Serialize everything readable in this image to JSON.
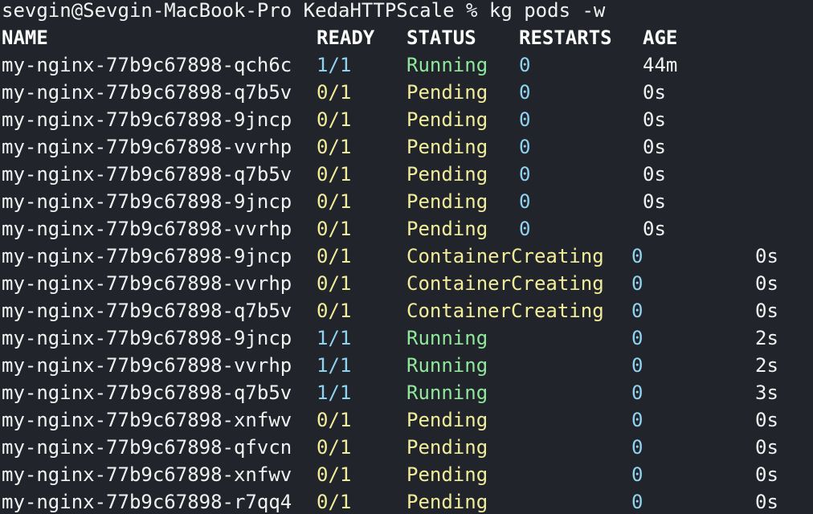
{
  "prompt": {
    "text": "sevgin@Sevgin-MacBook-Pro KedaHTTPScale % kg pods -w"
  },
  "header": {
    "name": "NAME",
    "ready": "READY",
    "status": "STATUS",
    "restarts": "RESTARTS",
    "age": "AGE"
  },
  "rows": [
    {
      "name": "my-nginx-77b9c67898-qch6c",
      "ready": "1/1",
      "status": "Running",
      "restarts": "0",
      "age": "44m"
    },
    {
      "name": "my-nginx-77b9c67898-q7b5v",
      "ready": "0/1",
      "status": "Pending",
      "restarts": "0",
      "age": "0s"
    },
    {
      "name": "my-nginx-77b9c67898-9jncp",
      "ready": "0/1",
      "status": "Pending",
      "restarts": "0",
      "age": "0s"
    },
    {
      "name": "my-nginx-77b9c67898-vvrhp",
      "ready": "0/1",
      "status": "Pending",
      "restarts": "0",
      "age": "0s"
    },
    {
      "name": "my-nginx-77b9c67898-q7b5v",
      "ready": "0/1",
      "status": "Pending",
      "restarts": "0",
      "age": "0s"
    },
    {
      "name": "my-nginx-77b9c67898-9jncp",
      "ready": "0/1",
      "status": "Pending",
      "restarts": "0",
      "age": "0s"
    },
    {
      "name": "my-nginx-77b9c67898-vvrhp",
      "ready": "0/1",
      "status": "Pending",
      "restarts": "0",
      "age": "0s"
    },
    {
      "name": "my-nginx-77b9c67898-9jncp",
      "ready": "0/1",
      "status": "ContainerCreating",
      "restarts": "0",
      "age": "0s"
    },
    {
      "name": "my-nginx-77b9c67898-vvrhp",
      "ready": "0/1",
      "status": "ContainerCreating",
      "restarts": "0",
      "age": "0s"
    },
    {
      "name": "my-nginx-77b9c67898-q7b5v",
      "ready": "0/1",
      "status": "ContainerCreating",
      "restarts": "0",
      "age": "0s"
    },
    {
      "name": "my-nginx-77b9c67898-9jncp",
      "ready": "1/1",
      "status": "Running",
      "restarts": "0",
      "age": "2s"
    },
    {
      "name": "my-nginx-77b9c67898-vvrhp",
      "ready": "1/1",
      "status": "Running",
      "restarts": "0",
      "age": "2s"
    },
    {
      "name": "my-nginx-77b9c67898-q7b5v",
      "ready": "1/1",
      "status": "Running",
      "restarts": "0",
      "age": "3s"
    },
    {
      "name": "my-nginx-77b9c67898-xnfwv",
      "ready": "0/1",
      "status": "Pending",
      "restarts": "0",
      "age": "0s"
    },
    {
      "name": "my-nginx-77b9c67898-qfvcn",
      "ready": "0/1",
      "status": "Pending",
      "restarts": "0",
      "age": "0s"
    },
    {
      "name": "my-nginx-77b9c67898-xnfwv",
      "ready": "0/1",
      "status": "Pending",
      "restarts": "0",
      "age": "0s"
    },
    {
      "name": "my-nginx-77b9c67898-r7qq4",
      "ready": "0/1",
      "status": "Pending",
      "restarts": "0",
      "age": "0s"
    }
  ],
  "colors": {
    "background": "#21252b",
    "foreground": "#f2f2f2",
    "running": "#8fe89b",
    "pending": "#f2ed9a",
    "ready_full": "#8fd3f0",
    "restarts": "#8fd3f0"
  }
}
